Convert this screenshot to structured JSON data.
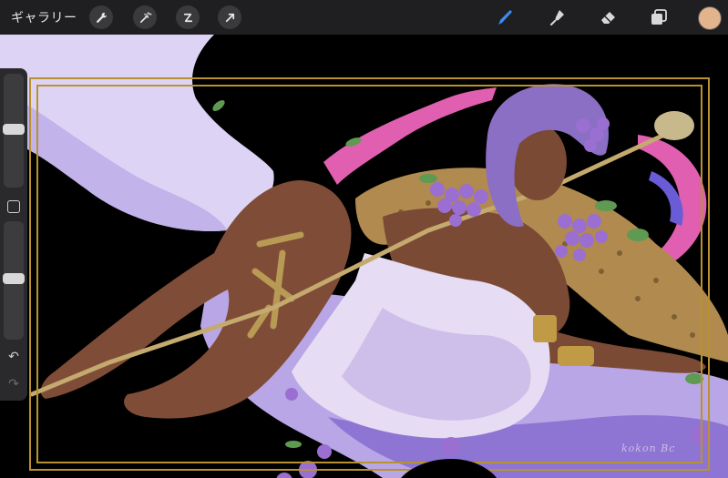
{
  "topbar": {
    "gallery_label": "ギャラリー",
    "left_tools": [
      {
        "name": "actions",
        "icon": "wrench-icon"
      },
      {
        "name": "adjustments",
        "icon": "magic-wand-icon"
      },
      {
        "name": "selection",
        "icon": "selection-s-icon"
      },
      {
        "name": "transform",
        "icon": "arrow-cursor-icon"
      }
    ],
    "right_tools": [
      {
        "name": "brush",
        "icon": "brush-icon",
        "active": true
      },
      {
        "name": "smudge",
        "icon": "smudge-icon"
      },
      {
        "name": "eraser",
        "icon": "eraser-icon"
      },
      {
        "name": "layers",
        "icon": "layers-icon"
      }
    ],
    "current_color": "#e2b48e"
  },
  "sidebar": {
    "brush_size_level": 0.55,
    "opacity_level": 0.55
  },
  "canvas": {
    "signature": "kokon Bc",
    "colors": {
      "background": "#000000",
      "frame": "#b8922e",
      "cloth_light": "#e6dcf3",
      "cloth_mid": "#b9a3e0",
      "skin": "#7a4a35",
      "hair": "#8a6fc4",
      "grapes": "#9a6fd1",
      "ribbon": "#e05fb0",
      "leopard": "#b08a4f"
    }
  }
}
